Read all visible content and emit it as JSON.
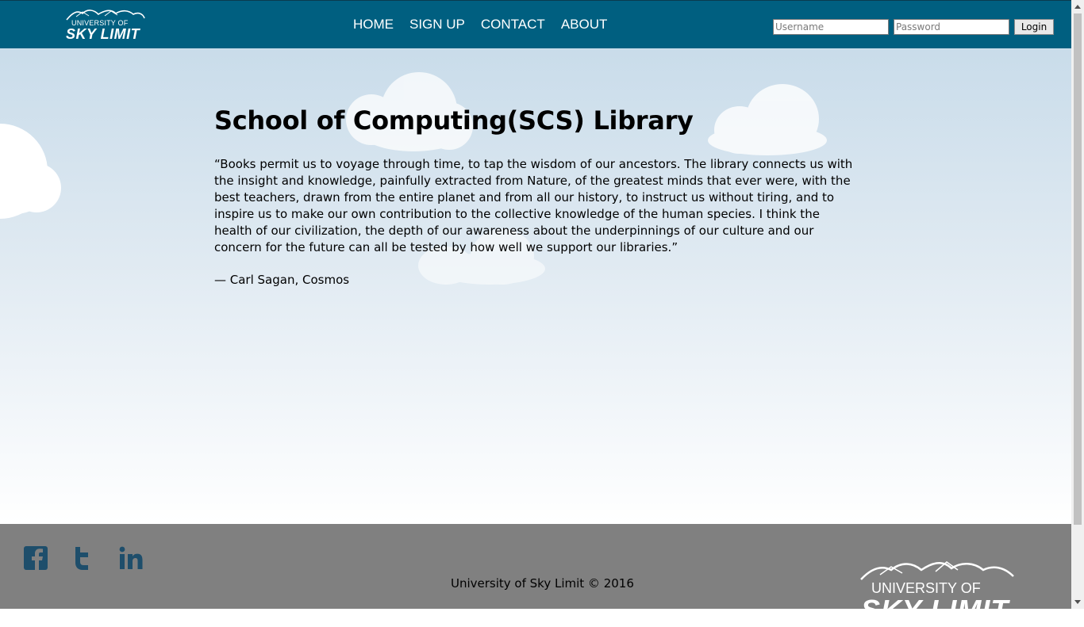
{
  "header": {
    "logo": {
      "line1": "UNIVERSITY OF",
      "line2": "SKY LIMIT"
    },
    "nav": [
      "HOME",
      "SIGN UP",
      "CONTACT",
      "ABOUT"
    ],
    "login": {
      "username_placeholder": "Username",
      "password_placeholder": "Password",
      "button_label": "Login"
    }
  },
  "main": {
    "title": "School of Computing(SCS) Library",
    "quote": "“Books permit us to voyage through time, to tap the wisdom of our ancestors. The library connects us with the insight and knowledge, painfully extracted from Nature, of the greatest minds that ever were, with the best teachers, drawn from the entire planet and from all our history, to instruct us without tiring, and to inspire us to make our own contribution to the collective knowledge of the human species. I think the health of our civilization, the depth of our awareness about the underpinnings of our culture and our concern for the future can all be tested by how well we support our libraries.”",
    "author": "— Carl Sagan, Cosmos"
  },
  "footer": {
    "social": [
      "facebook-icon",
      "twitter-icon",
      "linkedin-icon"
    ],
    "copyright": "University of Sky Limit © 2016",
    "logo": {
      "line1": "UNIVERSITY OF",
      "line2": "SKY LIMIT"
    }
  },
  "colors": {
    "header_bg": "#005f80",
    "footer_bg": "#808080",
    "social_icon": "#1e4e6b"
  }
}
